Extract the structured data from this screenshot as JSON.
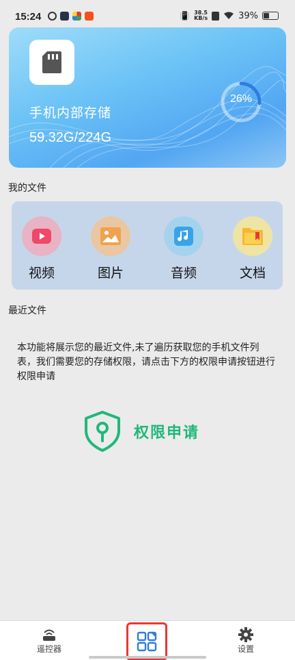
{
  "status_bar": {
    "time": "15:24",
    "net_speed_value": "38.5",
    "net_speed_unit": "KB/s",
    "battery": "39%"
  },
  "storage": {
    "title": "手机内部存储",
    "size": "59.32G/224G",
    "usage_percent_label": "26%",
    "usage_fraction": 0.26
  },
  "my_files": {
    "label": "我的文件",
    "categories": [
      {
        "label": "视频",
        "icon": "video-icon"
      },
      {
        "label": "图片",
        "icon": "image-icon"
      },
      {
        "label": "音频",
        "icon": "music-icon"
      },
      {
        "label": "文档",
        "icon": "folder-icon"
      }
    ]
  },
  "recent_files": {
    "label": "最近文件",
    "message": "本功能将展示您的最近文件,未了遍历获取您的手机文件列表，我们需要您的存储权限，请点击下方的权限申请按钮进行权限申请",
    "permission_button": "权限申请"
  },
  "bottom_nav": {
    "remote_label": "遥控器",
    "settings_label": "设置"
  },
  "colors": {
    "accent_green": "#21b77a",
    "card_blue": "#6cc3f6",
    "highlight_red": "#e53935"
  }
}
